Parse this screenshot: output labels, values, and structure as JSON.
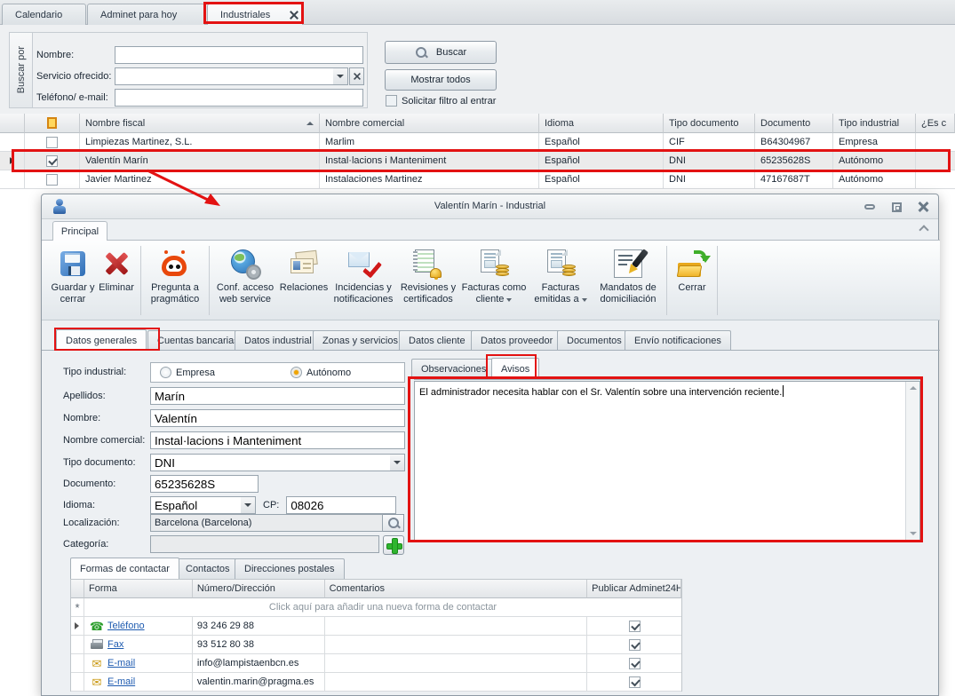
{
  "colors": {
    "annotation_red": "#e31212",
    "link_blue": "#1e5bb0",
    "robot_orange": "#e8480c"
  },
  "main_window": {
    "tabs": [
      {
        "label": "Calendario"
      },
      {
        "label": "Adminet para hoy"
      },
      {
        "label": "Industriales",
        "close_icon": "close-icon"
      }
    ],
    "search": {
      "group_label": "Buscar por",
      "nombre_label": "Nombre:",
      "servicio_label": "Servicio ofrecido:",
      "telefono_label": "Teléfono/ e-mail:",
      "nombre_value": "",
      "servicio_value": "",
      "telefono_value": "",
      "buscar_button": "Buscar",
      "buscar_icon": "magnifier-icon",
      "mostrar_todos_button": "Mostrar todos",
      "filtro_checkbox_label": "Solicitar filtro al entrar",
      "filtro_checkbox_checked": false
    },
    "grid": {
      "columns": {
        "c2": "Nombre fiscal",
        "c3": "Nombre comercial",
        "c4": "Idioma",
        "c5": "Tipo documento",
        "c6": "Documento",
        "c7": "Tipo industrial",
        "c8": "¿Es c"
      },
      "sort": "Nombre fiscal ascending",
      "rows": [
        {
          "checked": false,
          "selected": false,
          "nombre_fiscal": "Limpiezas Martinez, S.L.",
          "nombre_comercial": "Marlim",
          "idioma": "Español",
          "tipo_documento": "CIF",
          "documento": "B64304967",
          "tipo_industrial": "Empresa"
        },
        {
          "checked": true,
          "selected": true,
          "nombre_fiscal": "Valentín Marín",
          "nombre_comercial": "Instal·lacions i Manteniment",
          "idioma": "Español",
          "tipo_documento": "DNI",
          "documento": "65235628S",
          "tipo_industrial": "Autónomo"
        },
        {
          "checked": false,
          "selected": false,
          "nombre_fiscal": "Javier Martinez",
          "nombre_comercial": "Instalaciones Martinez",
          "idioma": "Español",
          "tipo_documento": "DNI",
          "documento": "47167687T",
          "tipo_industrial": "Autónomo"
        }
      ]
    }
  },
  "dialog": {
    "title": "Valentín Marín - Industrial",
    "ribbon_tab": "Principal",
    "toolbar": [
      {
        "label": "Guardar y cerrar",
        "icon": "save-icon"
      },
      {
        "label": "Eliminar",
        "icon": "delete-icon"
      },
      {
        "label": "Pregunta a pragmático",
        "icon": "robot-icon"
      },
      {
        "label": "Conf. acceso web service",
        "icon": "globe-gear-icon"
      },
      {
        "label": "Relaciones",
        "icon": "contact-cards-icon"
      },
      {
        "label": "Incidencias y notificaciones",
        "icon": "mail-check-icon"
      },
      {
        "label": "Revisiones y certificados",
        "icon": "notebook-bell-icon"
      },
      {
        "label": "Facturas como cliente",
        "icon": "invoice-coins-icon",
        "dropdown": true
      },
      {
        "label": "Facturas emitidas a",
        "icon": "invoice-coins-icon",
        "dropdown": true
      },
      {
        "label": "Mandatos de domiciliación",
        "icon": "document-pen-icon"
      },
      {
        "label": "Cerrar",
        "icon": "folder-arrow-icon"
      }
    ],
    "page_tabs": [
      {
        "label": "Datos generales",
        "active": true
      },
      {
        "label": "Cuentas bancarias"
      },
      {
        "label": "Datos industrial"
      },
      {
        "label": "Zonas y servicios"
      },
      {
        "label": "Datos cliente"
      },
      {
        "label": "Datos proveedor"
      },
      {
        "label": "Documentos"
      },
      {
        "label": "Envío notificaciones"
      }
    ],
    "form": {
      "tipo_label": "Tipo industrial:",
      "radio_empresa": "Empresa",
      "radio_autonomo": "Autónomo",
      "radio_selected": "Autónomo",
      "apellidos_label": "Apellidos:",
      "apellidos": "Marín",
      "nombre_label": "Nombre:",
      "nombre": "Valentín",
      "nombre_comercial_label": "Nombre comercial:",
      "nombre_comercial": "Instal·lacions i Manteniment",
      "tipo_doc_label": "Tipo documento:",
      "tipo_doc": "DNI",
      "documento_label": "Documento:",
      "documento": "65235628S",
      "idioma_label": "Idioma:",
      "idioma": "Español",
      "cp_label": "CP:",
      "cp": "08026",
      "localizacion_label": "Localización:",
      "localizacion": "Barcelona (Barcelona)",
      "categoria_label": "Categoría:",
      "categoria": ""
    },
    "notes": {
      "tab_observaciones": "Observaciones",
      "tab_avisos": "Avisos",
      "active_tab": "Avisos",
      "avisos_text": "El administrador necesita hablar con el Sr. Valentín sobre una intervención reciente."
    },
    "contacts": {
      "tabs": [
        {
          "label": "Formas de contactar",
          "active": true
        },
        {
          "label": "Contactos"
        },
        {
          "label": "Direcciones postales"
        }
      ],
      "columns": {
        "forma": "Forma",
        "numero": "Número/Dirección",
        "comentarios": "Comentarios",
        "publicar": "Publicar Adminet24H"
      },
      "new_row_text": "Click aquí para añadir una nueva forma de contactar",
      "rows": [
        {
          "icon": "phone-icon",
          "forma": "Teléfono",
          "valor": "93 246 29 88",
          "comentarios": "",
          "publicar": true
        },
        {
          "icon": "fax-icon",
          "forma": "Fax",
          "valor": "93 512 80 38",
          "comentarios": "",
          "publicar": true
        },
        {
          "icon": "email-icon",
          "forma": "E-mail",
          "valor": "info@lampistaenbcn.es",
          "comentarios": "",
          "publicar": true
        },
        {
          "icon": "email-icon",
          "forma": "E-mail",
          "valor": "valentin.marin@pragma.es",
          "comentarios": "",
          "publicar": true
        }
      ]
    }
  }
}
